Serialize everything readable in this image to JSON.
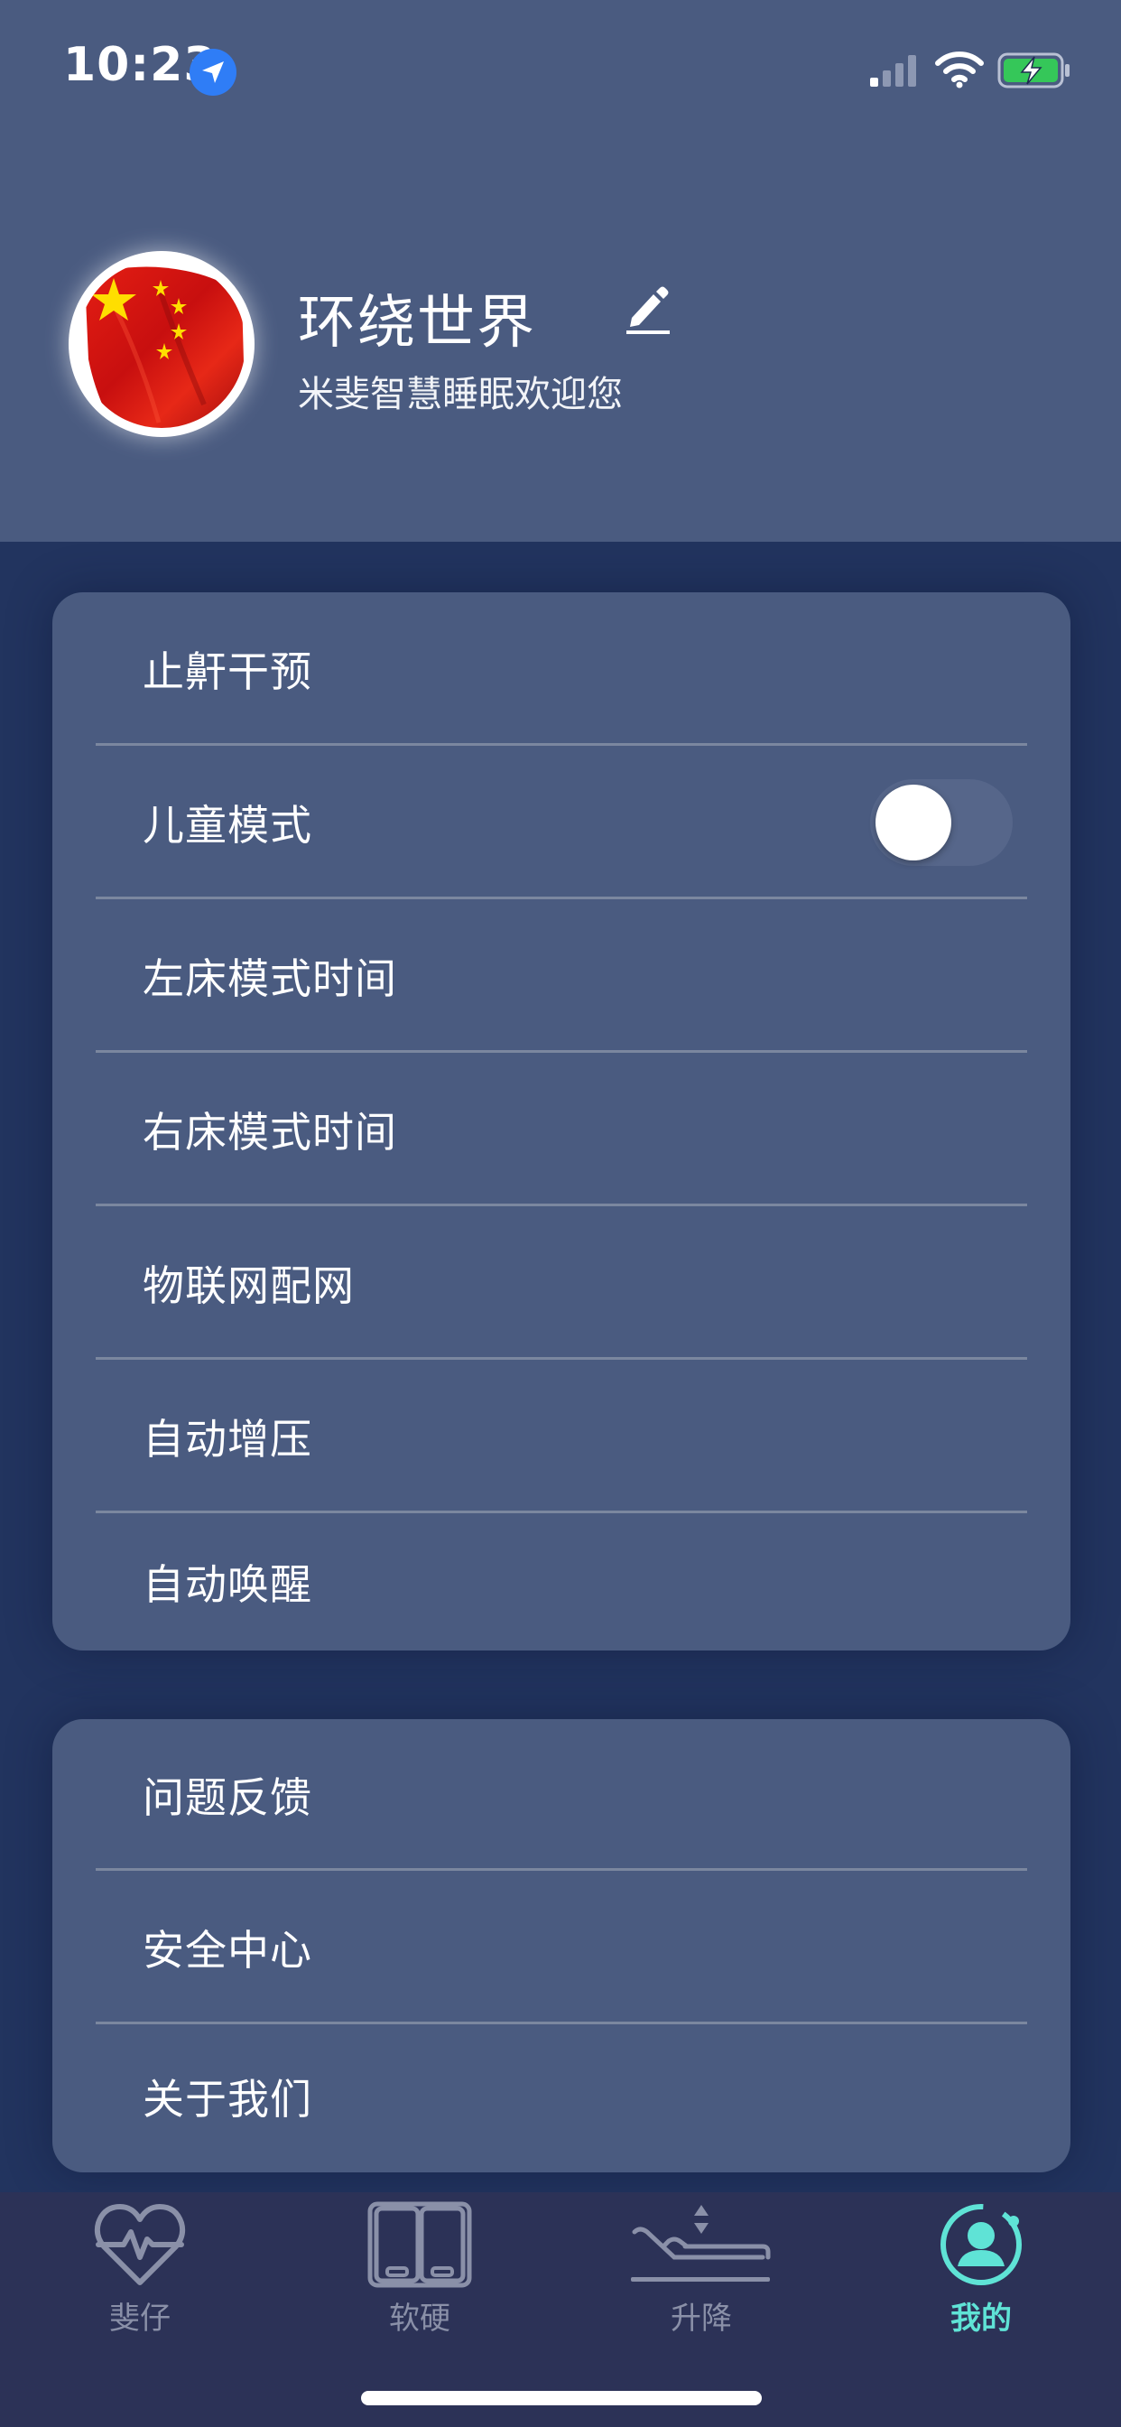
{
  "status_bar": {
    "time": "10:23"
  },
  "profile": {
    "username": "环绕世界",
    "welcome": "米斐智慧睡眠欢迎您"
  },
  "settings_group_1": {
    "items": [
      {
        "label": "止鼾干预"
      },
      {
        "label": "儿童模式",
        "toggle": false
      },
      {
        "label": "左床模式时间"
      },
      {
        "label": "右床模式时间"
      },
      {
        "label": "物联网配网"
      },
      {
        "label": "自动增压"
      },
      {
        "label": "自动唤醒"
      }
    ]
  },
  "settings_group_2": {
    "items": [
      {
        "label": "问题反馈"
      },
      {
        "label": "安全中心"
      },
      {
        "label": "关于我们"
      }
    ]
  },
  "tabbar": {
    "tabs": [
      {
        "label": "斐仔",
        "icon": "heart-pulse-icon"
      },
      {
        "label": "软硬",
        "icon": "mattress-icon"
      },
      {
        "label": "升降",
        "icon": "bed-lift-icon"
      },
      {
        "label": "我的",
        "icon": "user-profile-icon"
      }
    ],
    "active_index": 3
  },
  "colors": {
    "header_bg": "#4a5b80",
    "page_bg": "#22345f",
    "card_bg": "#4a5b80",
    "tabbar_bg": "#2c3257",
    "active_tab": "#5fe3d6",
    "inactive_tab": "#8a90a8"
  }
}
